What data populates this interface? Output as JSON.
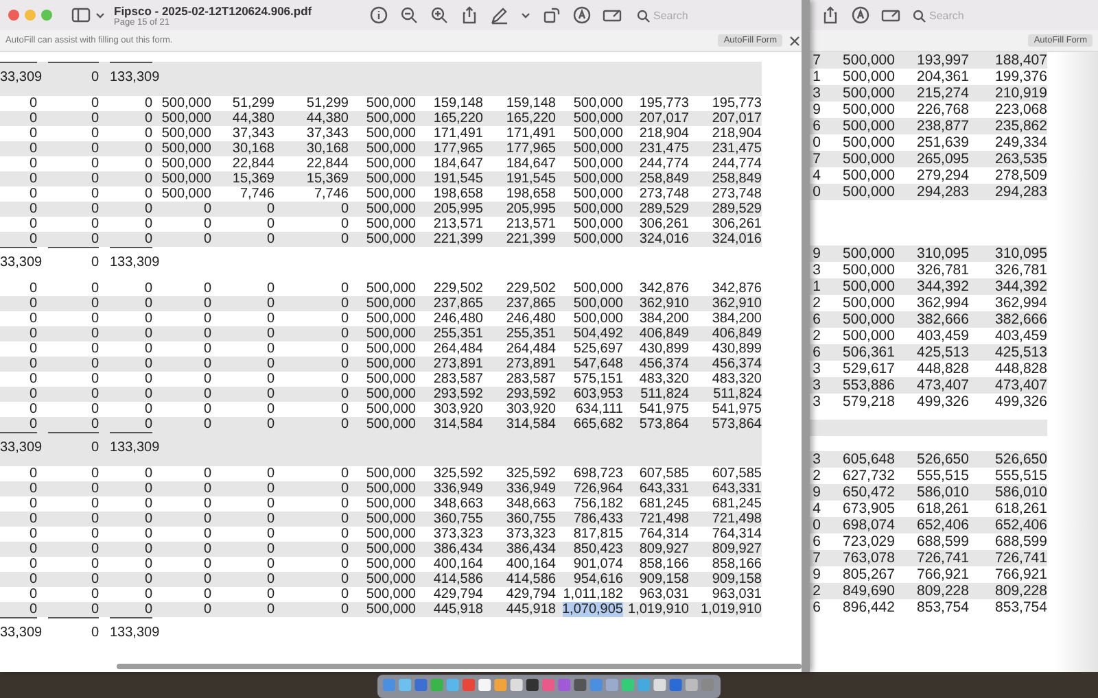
{
  "front_window": {
    "title": "Fipsco - 2025-02-12T120624.906.pdf",
    "subtitle": "Page 15 of 21",
    "search": {
      "placeholder": "Search"
    },
    "autofill_bar": {
      "message": "AutoFill can assist with filling out this form.",
      "button": "AutoFill Form"
    },
    "table": {
      "rows": [
        {
          "kind": "total",
          "cells": [
            "33,309",
            "0",
            "133,309"
          ]
        },
        {
          "kind": "data",
          "cells": [
            "0",
            "0",
            "0",
            "500,000",
            "51,299",
            "51,299",
            "500,000",
            "159,148",
            "159,148",
            "500,000",
            "195,773",
            "195,773"
          ]
        },
        {
          "kind": "data",
          "cells": [
            "0",
            "0",
            "0",
            "500,000",
            "44,380",
            "44,380",
            "500,000",
            "165,220",
            "165,220",
            "500,000",
            "207,017",
            "207,017"
          ]
        },
        {
          "kind": "data",
          "cells": [
            "0",
            "0",
            "0",
            "500,000",
            "37,343",
            "37,343",
            "500,000",
            "171,491",
            "171,491",
            "500,000",
            "218,904",
            "218,904"
          ]
        },
        {
          "kind": "data",
          "cells": [
            "0",
            "0",
            "0",
            "500,000",
            "30,168",
            "30,168",
            "500,000",
            "177,965",
            "177,965",
            "500,000",
            "231,475",
            "231,475"
          ]
        },
        {
          "kind": "data",
          "cells": [
            "0",
            "0",
            "0",
            "500,000",
            "22,844",
            "22,844",
            "500,000",
            "184,647",
            "184,647",
            "500,000",
            "244,774",
            "244,774"
          ]
        },
        {
          "kind": "data",
          "cells": [
            "0",
            "0",
            "0",
            "500,000",
            "15,369",
            "15,369",
            "500,000",
            "191,545",
            "191,545",
            "500,000",
            "258,849",
            "258,849"
          ]
        },
        {
          "kind": "data",
          "cells": [
            "0",
            "0",
            "0",
            "500,000",
            "7,746",
            "7,746",
            "500,000",
            "198,658",
            "198,658",
            "500,000",
            "273,748",
            "273,748"
          ]
        },
        {
          "kind": "data",
          "cells": [
            "0",
            "0",
            "0",
            "0",
            "0",
            "0",
            "500,000",
            "205,995",
            "205,995",
            "500,000",
            "289,529",
            "289,529"
          ]
        },
        {
          "kind": "data",
          "cells": [
            "0",
            "0",
            "0",
            "0",
            "0",
            "0",
            "500,000",
            "213,571",
            "213,571",
            "500,000",
            "306,261",
            "306,261"
          ]
        },
        {
          "kind": "data",
          "cells": [
            "0",
            "0",
            "0",
            "0",
            "0",
            "0",
            "500,000",
            "221,399",
            "221,399",
            "500,000",
            "324,016",
            "324,016"
          ]
        },
        {
          "kind": "total",
          "cells": [
            "33,309",
            "0",
            "133,309"
          ]
        },
        {
          "kind": "data",
          "cells": [
            "0",
            "0",
            "0",
            "0",
            "0",
            "0",
            "500,000",
            "229,502",
            "229,502",
            "500,000",
            "342,876",
            "342,876"
          ]
        },
        {
          "kind": "data",
          "cells": [
            "0",
            "0",
            "0",
            "0",
            "0",
            "0",
            "500,000",
            "237,865",
            "237,865",
            "500,000",
            "362,910",
            "362,910"
          ]
        },
        {
          "kind": "data",
          "cells": [
            "0",
            "0",
            "0",
            "0",
            "0",
            "0",
            "500,000",
            "246,480",
            "246,480",
            "500,000",
            "384,200",
            "384,200"
          ]
        },
        {
          "kind": "data",
          "cells": [
            "0",
            "0",
            "0",
            "0",
            "0",
            "0",
            "500,000",
            "255,351",
            "255,351",
            "504,492",
            "406,849",
            "406,849"
          ]
        },
        {
          "kind": "data",
          "cells": [
            "0",
            "0",
            "0",
            "0",
            "0",
            "0",
            "500,000",
            "264,484",
            "264,484",
            "525,697",
            "430,899",
            "430,899"
          ]
        },
        {
          "kind": "data",
          "cells": [
            "0",
            "0",
            "0",
            "0",
            "0",
            "0",
            "500,000",
            "273,891",
            "273,891",
            "547,648",
            "456,374",
            "456,374"
          ]
        },
        {
          "kind": "data",
          "cells": [
            "0",
            "0",
            "0",
            "0",
            "0",
            "0",
            "500,000",
            "283,587",
            "283,587",
            "575,151",
            "483,320",
            "483,320"
          ]
        },
        {
          "kind": "data",
          "cells": [
            "0",
            "0",
            "0",
            "0",
            "0",
            "0",
            "500,000",
            "293,592",
            "293,592",
            "603,953",
            "511,824",
            "511,824"
          ]
        },
        {
          "kind": "data",
          "cells": [
            "0",
            "0",
            "0",
            "0",
            "0",
            "0",
            "500,000",
            "303,920",
            "303,920",
            "634,111",
            "541,975",
            "541,975"
          ]
        },
        {
          "kind": "data",
          "cells": [
            "0",
            "0",
            "0",
            "0",
            "0",
            "0",
            "500,000",
            "314,584",
            "314,584",
            "665,682",
            "573,864",
            "573,864"
          ]
        },
        {
          "kind": "total",
          "cells": [
            "33,309",
            "0",
            "133,309"
          ]
        },
        {
          "kind": "data",
          "cells": [
            "0",
            "0",
            "0",
            "0",
            "0",
            "0",
            "500,000",
            "325,592",
            "325,592",
            "698,723",
            "607,585",
            "607,585"
          ]
        },
        {
          "kind": "data",
          "cells": [
            "0",
            "0",
            "0",
            "0",
            "0",
            "0",
            "500,000",
            "336,949",
            "336,949",
            "726,964",
            "643,331",
            "643,331"
          ]
        },
        {
          "kind": "data",
          "cells": [
            "0",
            "0",
            "0",
            "0",
            "0",
            "0",
            "500,000",
            "348,663",
            "348,663",
            "756,182",
            "681,245",
            "681,245"
          ]
        },
        {
          "kind": "data",
          "cells": [
            "0",
            "0",
            "0",
            "0",
            "0",
            "0",
            "500,000",
            "360,755",
            "360,755",
            "786,433",
            "721,498",
            "721,498"
          ]
        },
        {
          "kind": "data",
          "cells": [
            "0",
            "0",
            "0",
            "0",
            "0",
            "0",
            "500,000",
            "373,323",
            "373,323",
            "817,815",
            "764,314",
            "764,314"
          ]
        },
        {
          "kind": "data",
          "cells": [
            "0",
            "0",
            "0",
            "0",
            "0",
            "0",
            "500,000",
            "386,434",
            "386,434",
            "850,423",
            "809,927",
            "809,927"
          ]
        },
        {
          "kind": "data",
          "cells": [
            "0",
            "0",
            "0",
            "0",
            "0",
            "0",
            "500,000",
            "400,164",
            "400,164",
            "901,074",
            "858,166",
            "858,166"
          ]
        },
        {
          "kind": "data",
          "cells": [
            "0",
            "0",
            "0",
            "0",
            "0",
            "0",
            "500,000",
            "414,586",
            "414,586",
            "954,616",
            "909,158",
            "909,158"
          ]
        },
        {
          "kind": "data",
          "cells": [
            "0",
            "0",
            "0",
            "0",
            "0",
            "0",
            "500,000",
            "429,794",
            "429,794",
            "1,011,182",
            "963,031",
            "963,031"
          ]
        },
        {
          "kind": "data",
          "cells": [
            "0",
            "0",
            "0",
            "0",
            "0",
            "0",
            "500,000",
            "445,918",
            "445,918",
            {
              "text": "1,070,905",
              "selected": true
            },
            "1,019,910",
            "1,019,910"
          ]
        },
        {
          "kind": "total",
          "cells": [
            "33,309",
            "0",
            "133,309"
          ]
        }
      ]
    }
  },
  "back_window": {
    "search": {
      "placeholder": "Search"
    },
    "autofill_button": "AutoFill Form",
    "table": {
      "rows": [
        {
          "kind": "data",
          "cells": [
            "7",
            "500,000",
            "193,997",
            "188,407"
          ]
        },
        {
          "kind": "data",
          "cells": [
            "1",
            "500,000",
            "204,361",
            "199,376"
          ]
        },
        {
          "kind": "data",
          "cells": [
            "3",
            "500,000",
            "215,274",
            "210,919"
          ]
        },
        {
          "kind": "data",
          "cells": [
            "9",
            "500,000",
            "226,768",
            "223,068"
          ]
        },
        {
          "kind": "data",
          "cells": [
            "6",
            "500,000",
            "238,877",
            "235,862"
          ]
        },
        {
          "kind": "data",
          "cells": [
            "0",
            "500,000",
            "251,639",
            "249,334"
          ]
        },
        {
          "kind": "data",
          "cells": [
            "7",
            "500,000",
            "265,095",
            "263,535"
          ]
        },
        {
          "kind": "data",
          "cells": [
            "4",
            "500,000",
            "279,294",
            "278,509"
          ]
        },
        {
          "kind": "data",
          "cells": [
            "0",
            "500,000",
            "294,283",
            "294,283"
          ]
        },
        {
          "kind": "gap"
        },
        {
          "kind": "data",
          "cells": [
            "9",
            "500,000",
            "310,095",
            "310,095"
          ]
        },
        {
          "kind": "data",
          "cells": [
            "3",
            "500,000",
            "326,781",
            "326,781"
          ]
        },
        {
          "kind": "data",
          "cells": [
            "1",
            "500,000",
            "344,392",
            "344,392"
          ]
        },
        {
          "kind": "data",
          "cells": [
            "2",
            "500,000",
            "362,994",
            "362,994"
          ]
        },
        {
          "kind": "data",
          "cells": [
            "6",
            "500,000",
            "382,666",
            "382,666"
          ]
        },
        {
          "kind": "data",
          "cells": [
            "2",
            "500,000",
            "403,459",
            "403,459"
          ]
        },
        {
          "kind": "data",
          "cells": [
            "6",
            "506,361",
            "425,513",
            "425,513"
          ]
        },
        {
          "kind": "data",
          "cells": [
            "3",
            "529,617",
            "448,828",
            "448,828"
          ]
        },
        {
          "kind": "data",
          "cells": [
            "3",
            "553,886",
            "473,407",
            "473,407"
          ]
        },
        {
          "kind": "data",
          "cells": [
            "3",
            "579,218",
            "499,326",
            "499,326"
          ]
        },
        {
          "kind": "band"
        },
        {
          "kind": "data",
          "cells": [
            "3",
            "605,648",
            "526,650",
            "526,650"
          ]
        },
        {
          "kind": "data",
          "cells": [
            "2",
            "627,732",
            "555,515",
            "555,515"
          ]
        },
        {
          "kind": "data",
          "cells": [
            "9",
            "650,472",
            "586,010",
            "586,010"
          ]
        },
        {
          "kind": "data",
          "cells": [
            "4",
            "673,905",
            "618,261",
            "618,261"
          ]
        },
        {
          "kind": "data",
          "cells": [
            "0",
            "698,074",
            "652,406",
            "652,406"
          ]
        },
        {
          "kind": "data",
          "cells": [
            "6",
            "723,029",
            "688,599",
            "688,599"
          ]
        },
        {
          "kind": "data",
          "cells": [
            "7",
            "763,078",
            "726,741",
            "726,741"
          ]
        },
        {
          "kind": "data",
          "cells": [
            "9",
            "805,267",
            "766,921",
            "766,921"
          ]
        },
        {
          "kind": "data",
          "cells": [
            "2",
            "849,690",
            "809,228",
            "809,228"
          ]
        },
        {
          "kind": "data",
          "cells": [
            "6",
            "896,442",
            "853,754",
            "853,754"
          ]
        }
      ]
    }
  }
}
